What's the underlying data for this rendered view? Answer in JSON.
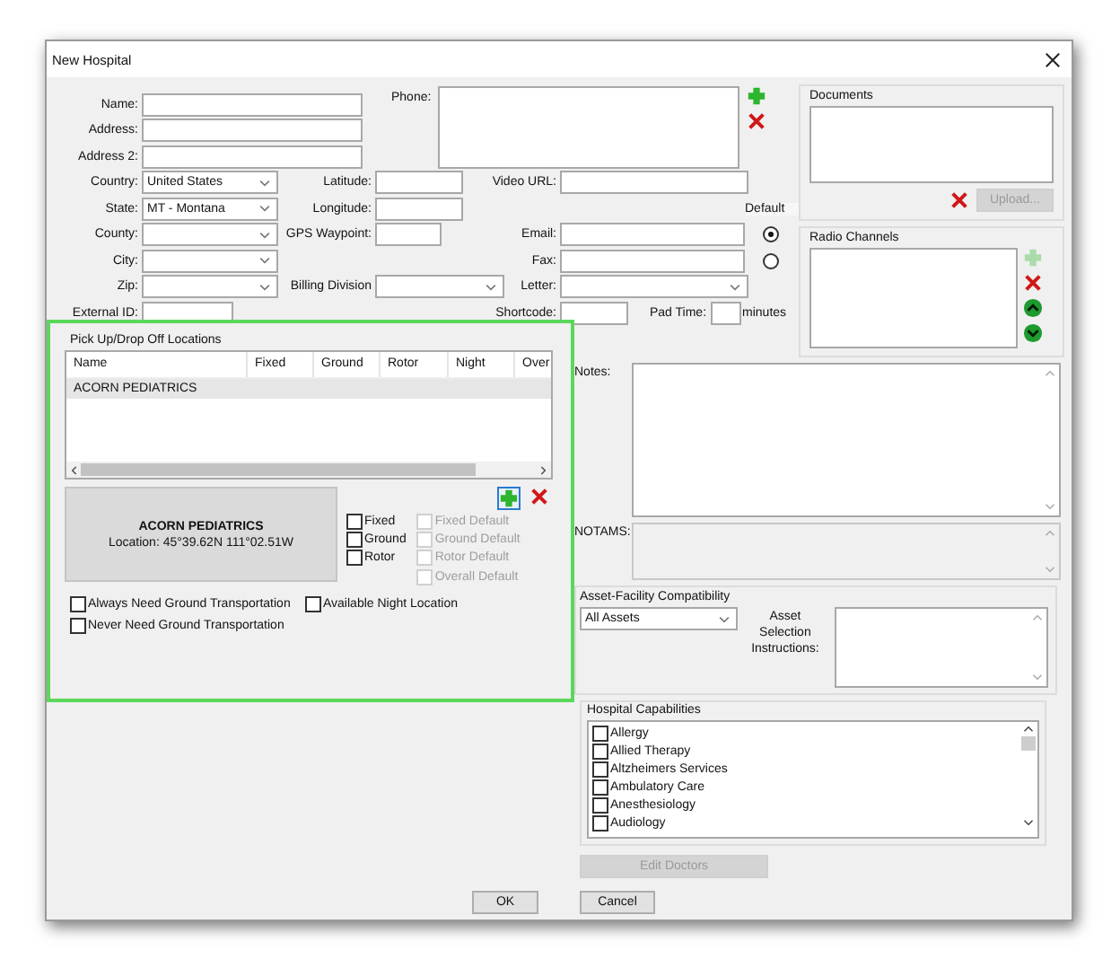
{
  "window": {
    "title": "New Hospital"
  },
  "fields": [
    {
      "label": "Name:",
      "kind": "text"
    },
    {
      "label": "Address:",
      "kind": "text"
    },
    {
      "label": "Address 2:",
      "kind": "text"
    },
    {
      "label": "Country:",
      "kind": "dropdown",
      "value": "United States"
    },
    {
      "label": "State:",
      "kind": "dropdown",
      "value": "MT - Montana"
    },
    {
      "label": "County:",
      "kind": "dropdown"
    },
    {
      "label": "City:",
      "kind": "dropdown"
    },
    {
      "label": "Zip:",
      "kind": "dropdown"
    },
    {
      "label": "External ID:",
      "kind": "short"
    }
  ],
  "coordinates": [
    {
      "label": "Latitude:",
      "kind": "text"
    },
    {
      "label": "Longitude:",
      "kind": "text"
    },
    {
      "label": "GPS Waypoint:",
      "kind": "short"
    },
    {
      "label": "Billing Division",
      "kind": "dropdown"
    }
  ],
  "phone": {
    "label": "Phone:"
  },
  "video_url": {
    "label": "Video URL:"
  },
  "default_label": "Default",
  "contacts": [
    {
      "label": "Email:",
      "kind": "text",
      "selected": true
    },
    {
      "label": "Fax:",
      "kind": "text",
      "selected": false
    },
    {
      "label": "Letter:",
      "kind": "dropdown"
    }
  ],
  "shortcode": {
    "label": "Shortcode:"
  },
  "pad_time": {
    "label": "Pad Time:",
    "unit": "minutes"
  },
  "documents": {
    "title": "Documents",
    "upload": "Upload...",
    "upload_disabled": true
  },
  "radio_channels": {
    "title": "Radio Channels",
    "add_disabled": true
  },
  "locations": {
    "title": "Pick Up/Drop Off Locations",
    "columns": [
      "Name",
      "Fixed",
      "Ground",
      "Rotor",
      "Night",
      "Over"
    ],
    "rows": [
      {
        "name": "ACORN PEDIATRICS",
        "selected": true
      }
    ],
    "card": {
      "name": "ACORN PEDIATRICS",
      "location": "Location: 45°39.62N 111°02.51W"
    },
    "modes": [
      {
        "label": "Fixed",
        "checked": false
      },
      {
        "label": "Ground",
        "checked": false
      },
      {
        "label": "Rotor",
        "checked": false
      }
    ],
    "defaults": [
      {
        "label": "Fixed Default",
        "checked": false,
        "disabled": true
      },
      {
        "label": "Ground Default",
        "checked": false,
        "disabled": true
      },
      {
        "label": "Rotor Default",
        "checked": false,
        "disabled": true
      },
      {
        "label": "Overall Default",
        "checked": false,
        "disabled": true
      }
    ],
    "options": [
      {
        "label": "Always Need Ground Transportation",
        "checked": false
      },
      {
        "label": "Available Night Location",
        "checked": false
      },
      {
        "label": "Never Need Ground Transportation",
        "checked": false
      }
    ]
  },
  "notes": {
    "label": "Notes:"
  },
  "notams": {
    "label": "NOTAMS:",
    "disabled": true
  },
  "asset": {
    "title": "Asset-Facility Compatibility",
    "value": "All Assets",
    "instructions_label": "Asset Selection Instructions:"
  },
  "capabilities": {
    "title": "Hospital Capabilities",
    "items": [
      {
        "label": "Allergy",
        "checked": false
      },
      {
        "label": "Allied Therapy",
        "checked": false
      },
      {
        "label": "Altzheimers Services",
        "checked": false
      },
      {
        "label": "Ambulatory Care",
        "checked": false
      },
      {
        "label": "Anesthesiology",
        "checked": false
      },
      {
        "label": "Audiology",
        "checked": false
      }
    ]
  },
  "edit_doctors": {
    "label": "Edit Doctors",
    "disabled": true
  },
  "buttons": [
    "OK",
    "Cancel"
  ]
}
